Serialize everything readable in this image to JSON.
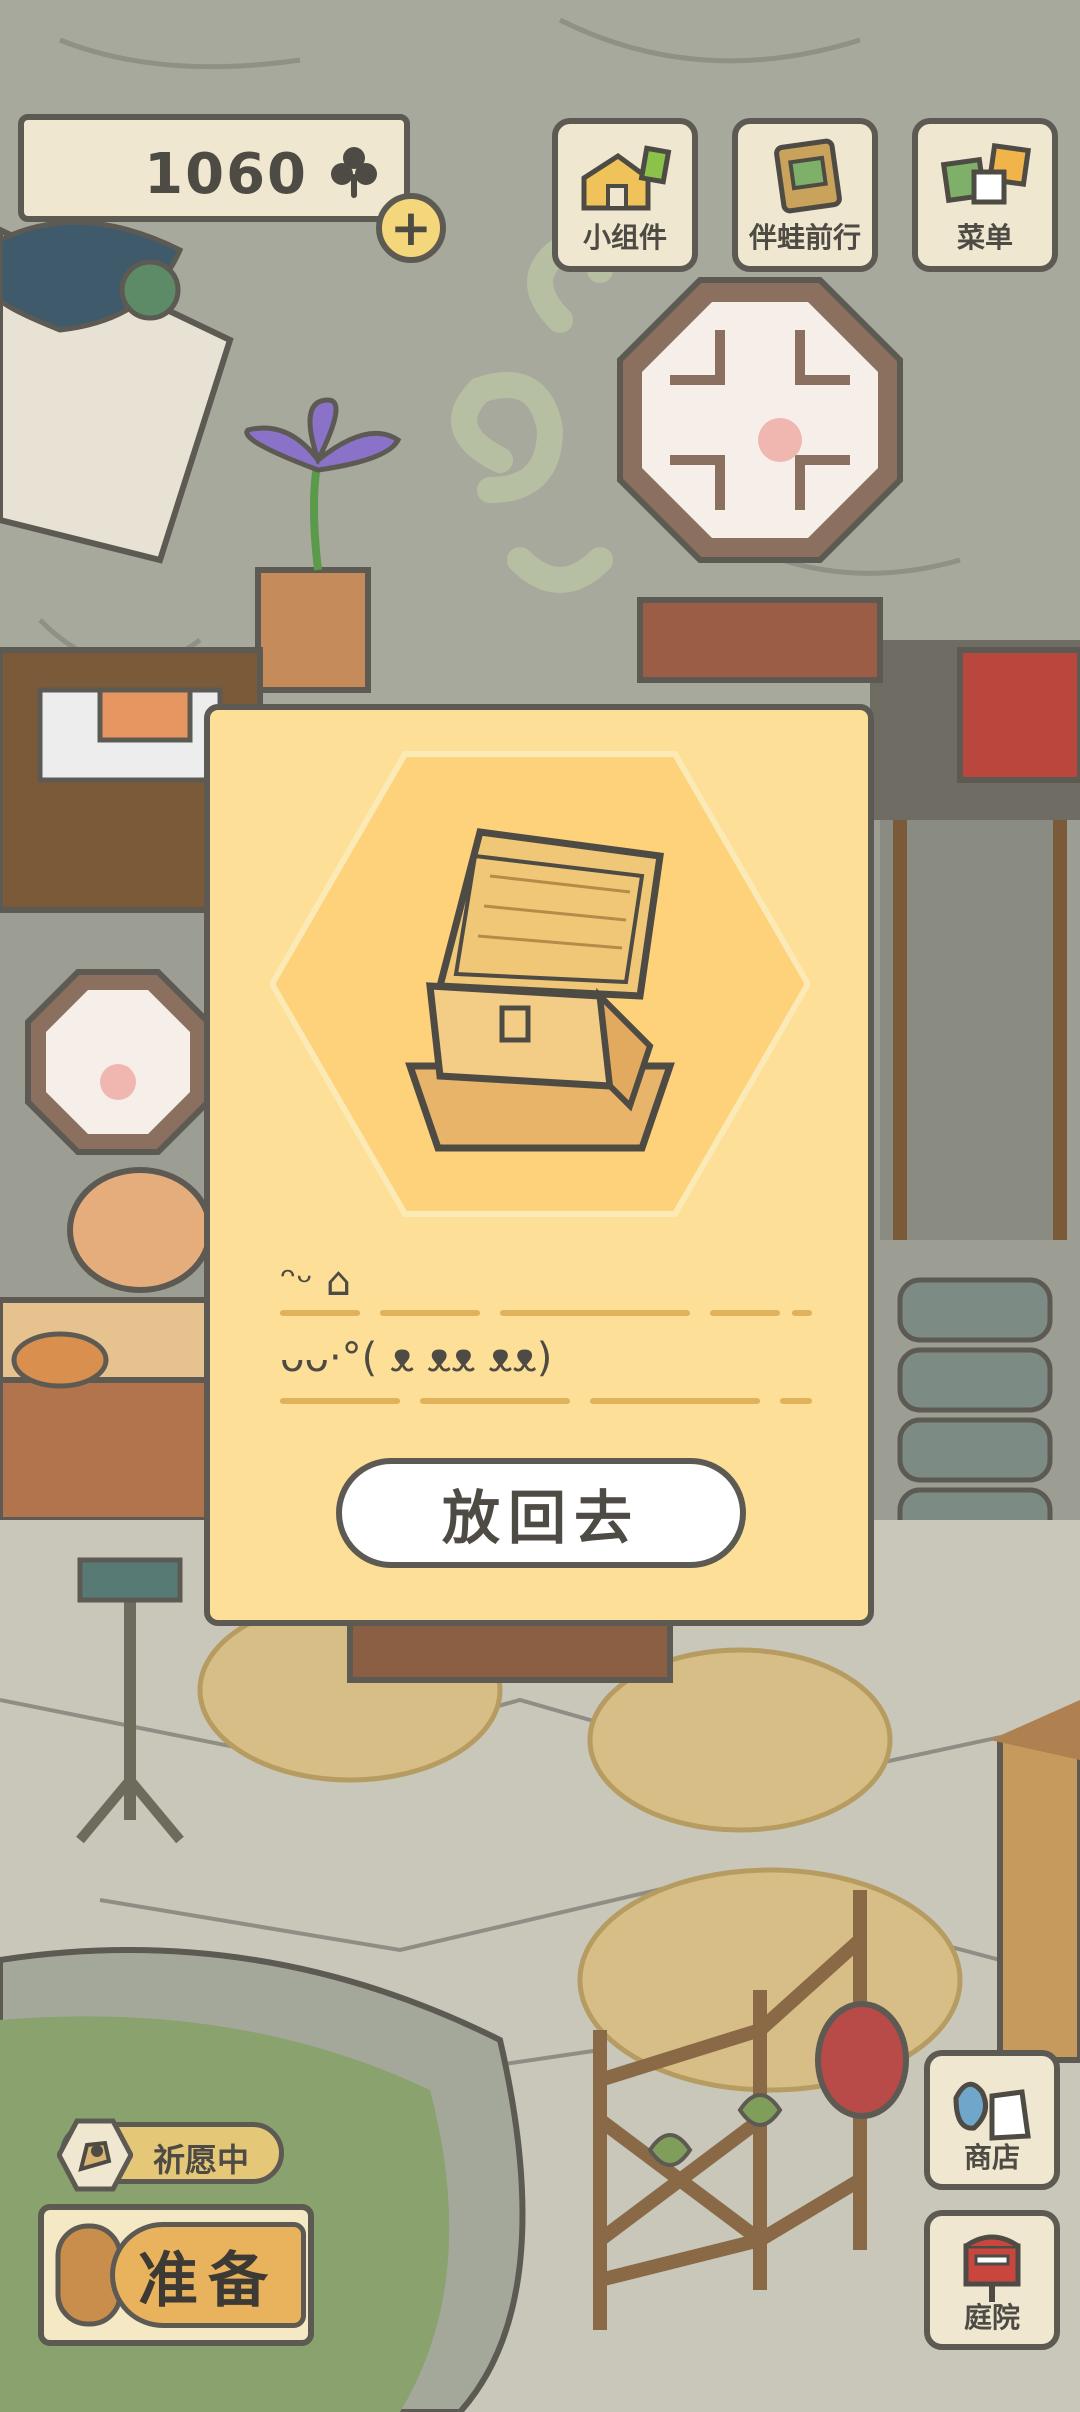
{
  "top_bar": {
    "clover_count": "1060",
    "add_symbol": "+",
    "buttons": [
      {
        "label": "小组件",
        "icon": "widget-icon"
      },
      {
        "label": "伴蛙前行",
        "icon": "frog-journal-icon"
      },
      {
        "label": "菜单",
        "icon": "menu-cards-icon"
      }
    ]
  },
  "dialog": {
    "item_icon": "wooden-chest-icon",
    "text_line_1": "ᵔᵕ ⌂",
    "text_line_2": "ᴗᴗ·°( ᴥ ᴥᴥ ᴥᴥ)",
    "put_back_label": "放回去"
  },
  "bottom": {
    "wish_label": "祈愿中",
    "prepare_label": "准备",
    "shop_label": "商店",
    "yard_label": "庭院"
  },
  "colors": {
    "panel": "#fddf97",
    "hexagon": "#fdd27a",
    "outline": "#5d5a53",
    "button_bg": "#efe7cf"
  }
}
